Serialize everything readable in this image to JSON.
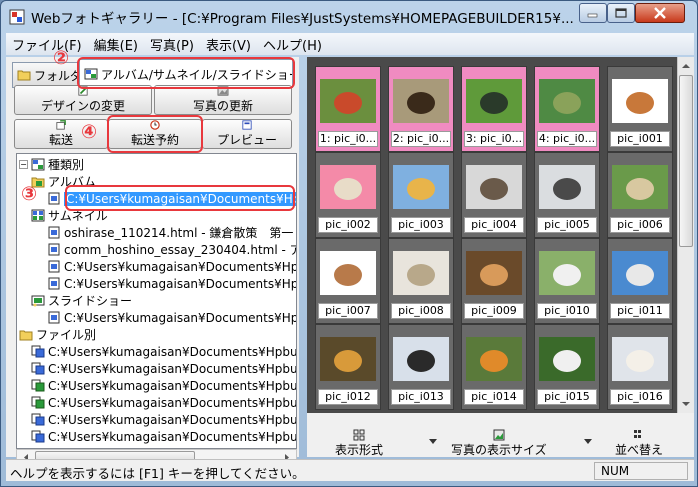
{
  "window": {
    "title": "Webフォトギャラリー - [C:¥Program Files¥JustSystems¥HOMEPAGEBUILDER15¥..."
  },
  "menu": [
    "ファイル(F)",
    "編集(E)",
    "写真(P)",
    "表示(V)",
    "ヘルプ(H)"
  ],
  "tabs": {
    "folder": "フォルダ",
    "album": "アルバム/サムネイル/スライドショー"
  },
  "toolbar": {
    "design": "デザインの変更",
    "photo_update": "写真の更新",
    "transfer": "転送",
    "transfer_schedule": "転送予約",
    "preview": "プレビュー"
  },
  "tree": {
    "root": "種類別",
    "album": "アルバム",
    "album_item": "C:¥Users¥kumagaisan¥Documents¥Hpbu",
    "thumbnail": "サムネイル",
    "thumb_items": [
      "oshirase_110214.html - 鎌倉散策　第一",
      "comm_hoshino_essay_230404.html - ア",
      "C:¥Users¥kumagaisan¥Documents¥Hpbu",
      "C:¥Users¥kumagaisan¥Documents¥Hpbu"
    ],
    "slideshow": "スライドショー",
    "slide_item": "C:¥Users¥kumagaisan¥Documents¥Hpbu",
    "by_file": "ファイル別",
    "file_items": [
      "C:¥Users¥kumagaisan¥Documents¥Hpbui",
      "C:¥Users¥kumagaisan¥Documents¥Hpbui",
      "C:¥Users¥kumagaisan¥Documents¥Hpbui",
      "C:¥Users¥kumagaisan¥Documents¥Hpbui",
      "C:¥Users¥kumagaisan¥Documents¥Hpbui",
      "C:¥Users¥kumagaisan¥Documents¥Hpbui"
    ]
  },
  "gallery": {
    "items": [
      {
        "label": "1: pic_i0...",
        "selected": true,
        "bg": "#6b8f3e",
        "accent": "#c94a2b"
      },
      {
        "label": "2: pic_i0...",
        "selected": true,
        "bg": "#a89a7a",
        "accent": "#3a2a1a"
      },
      {
        "label": "3: pic_i0...",
        "selected": true,
        "bg": "#5f9a3a",
        "accent": "#2a3a2a"
      },
      {
        "label": "4: pic_i0...",
        "selected": true,
        "bg": "#4f8a44",
        "accent": "#8aa25a"
      },
      {
        "label": "pic_i001",
        "selected": false,
        "bg": "#ffffff",
        "accent": "#c8783a"
      },
      {
        "label": "pic_i002",
        "selected": false,
        "bg": "#f48aa8",
        "accent": "#e8dcc8"
      },
      {
        "label": "pic_i003",
        "selected": false,
        "bg": "#7fb0e0",
        "accent": "#e8b44a"
      },
      {
        "label": "pic_i004",
        "selected": false,
        "bg": "#d8d8d8",
        "accent": "#6a5a4a"
      },
      {
        "label": "pic_i005",
        "selected": false,
        "bg": "#dadde0",
        "accent": "#4a4a4a"
      },
      {
        "label": "pic_i006",
        "selected": false,
        "bg": "#6a9a4a",
        "accent": "#d8c8a0"
      },
      {
        "label": "pic_i007",
        "selected": false,
        "bg": "#ffffff",
        "accent": "#b87a4a"
      },
      {
        "label": "pic_i008",
        "selected": false,
        "bg": "#e8e4dc",
        "accent": "#b8a88a"
      },
      {
        "label": "pic_i009",
        "selected": false,
        "bg": "#6a4a2a",
        "accent": "#d89a5a"
      },
      {
        "label": "pic_i010",
        "selected": false,
        "bg": "#8ab06a",
        "accent": "#f0f0f0"
      },
      {
        "label": "pic_i011",
        "selected": false,
        "bg": "#4a8ad0",
        "accent": "#e8e8e8"
      },
      {
        "label": "pic_i012",
        "selected": false,
        "bg": "#5a4a2a",
        "accent": "#d89a3a"
      },
      {
        "label": "pic_i013",
        "selected": false,
        "bg": "#d8e0ea",
        "accent": "#2a2a2a"
      },
      {
        "label": "pic_i014",
        "selected": false,
        "bg": "#5a7a3a",
        "accent": "#e08a2a"
      },
      {
        "label": "pic_i015",
        "selected": false,
        "bg": "#3a6a2a",
        "accent": "#f0f0f0"
      },
      {
        "label": "pic_i016",
        "selected": false,
        "bg": "#e0e4ea",
        "accent": "#f4f0e8"
      }
    ]
  },
  "bottom_tools": {
    "view_format": "表示形式",
    "photo_size": "写真の表示サイズ",
    "sort": "並べ替え"
  },
  "status": {
    "help_text": "ヘルプを表示するには [F1] キーを押してください。",
    "num": "NUM"
  },
  "annotations": [
    "②",
    "③",
    "④"
  ],
  "colors": {
    "selection_pink": "#f08bc1",
    "annotation_red": "#e8383d",
    "tree_highlight": "#3399ff"
  }
}
